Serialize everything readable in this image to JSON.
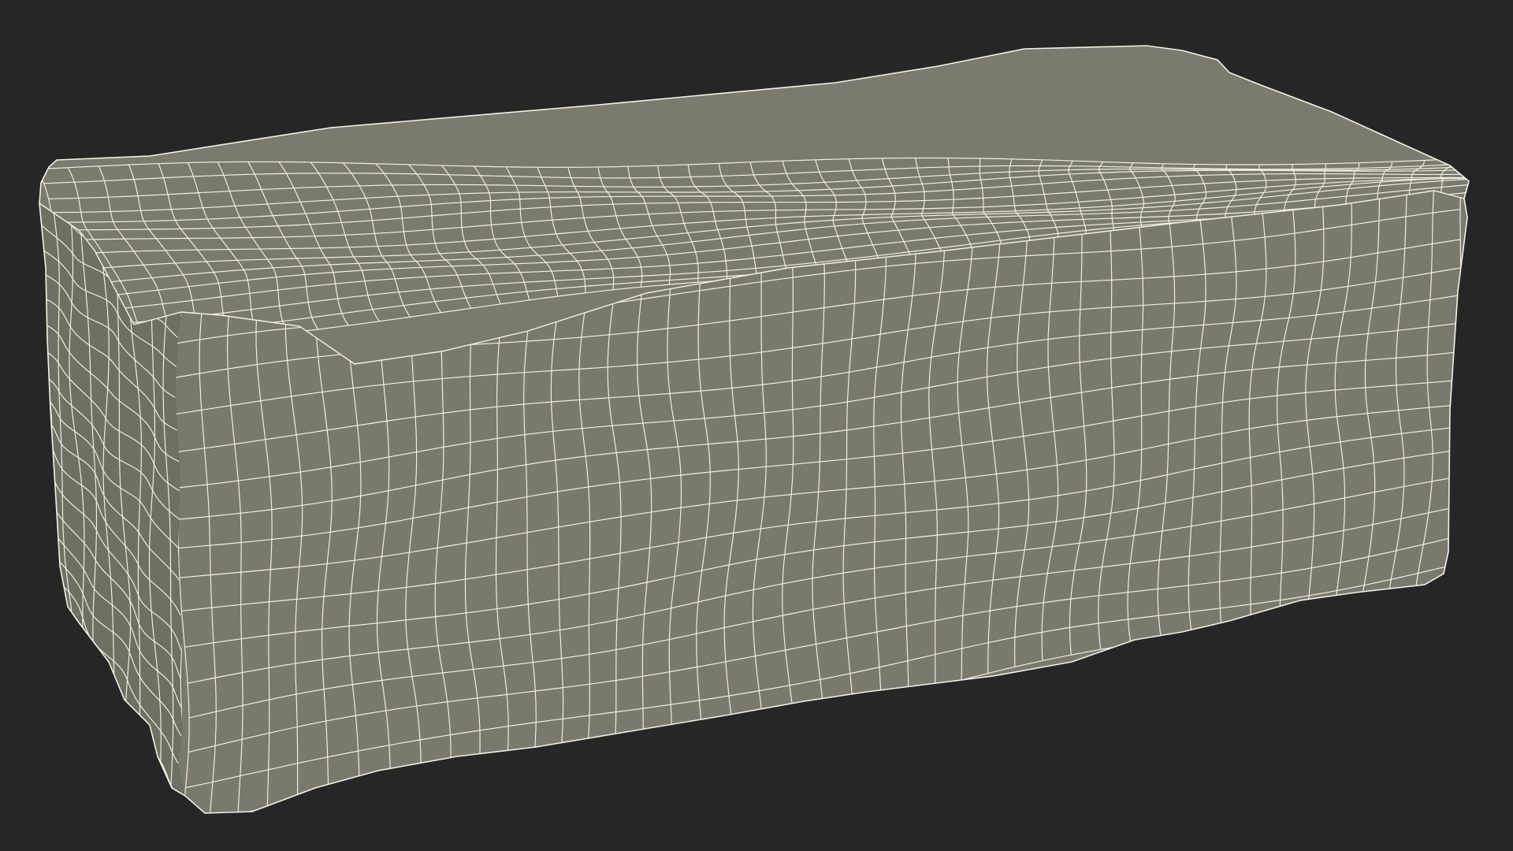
{
  "scene": {
    "subject": "draped-fabric-box-wireframe",
    "background_color": "#262626",
    "mesh_face_color": "#7a7b6e",
    "mesh_face_dark_color": "#6f7064",
    "wire_color": "#f3f1e4",
    "shading": "wireframe-over-shaded"
  }
}
